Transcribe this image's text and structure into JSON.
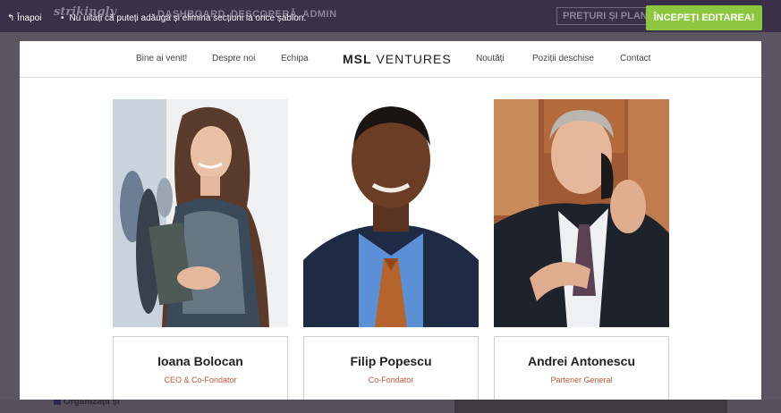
{
  "topbar": {
    "back_label": "Înapoi",
    "notice": "Nu uitați că puteți adăuga și elimina secțiuni la orice șablon.",
    "cta_label": "ÎNCEPEȚI EDITAREA!"
  },
  "background": {
    "brand": "strikingly",
    "nav": [
      "DASHBOARD",
      "DESCOPERĂ",
      "ADMIN"
    ],
    "pricing": "PREȚURI ȘI PLANURI",
    "org_label": "Organizații și"
  },
  "site": {
    "logo_bold": "MSL",
    "logo_light": "VENTURES",
    "nav": [
      "Bine ai venit!",
      "Despre noi",
      "Echipa",
      "Noutăți",
      "Poziții deschise",
      "Contact"
    ]
  },
  "team": [
    {
      "name": "Ioana Bolocan",
      "role": "CEO & Co-Fondator"
    },
    {
      "name": "Filip Popescu",
      "role": "Co-Fondator"
    },
    {
      "name": "Andrei Antonescu",
      "role": "Partener General"
    }
  ],
  "colors": {
    "accent": "#8dc63f",
    "role_text": "#c0593a",
    "topbar": "#3b2f4a"
  }
}
